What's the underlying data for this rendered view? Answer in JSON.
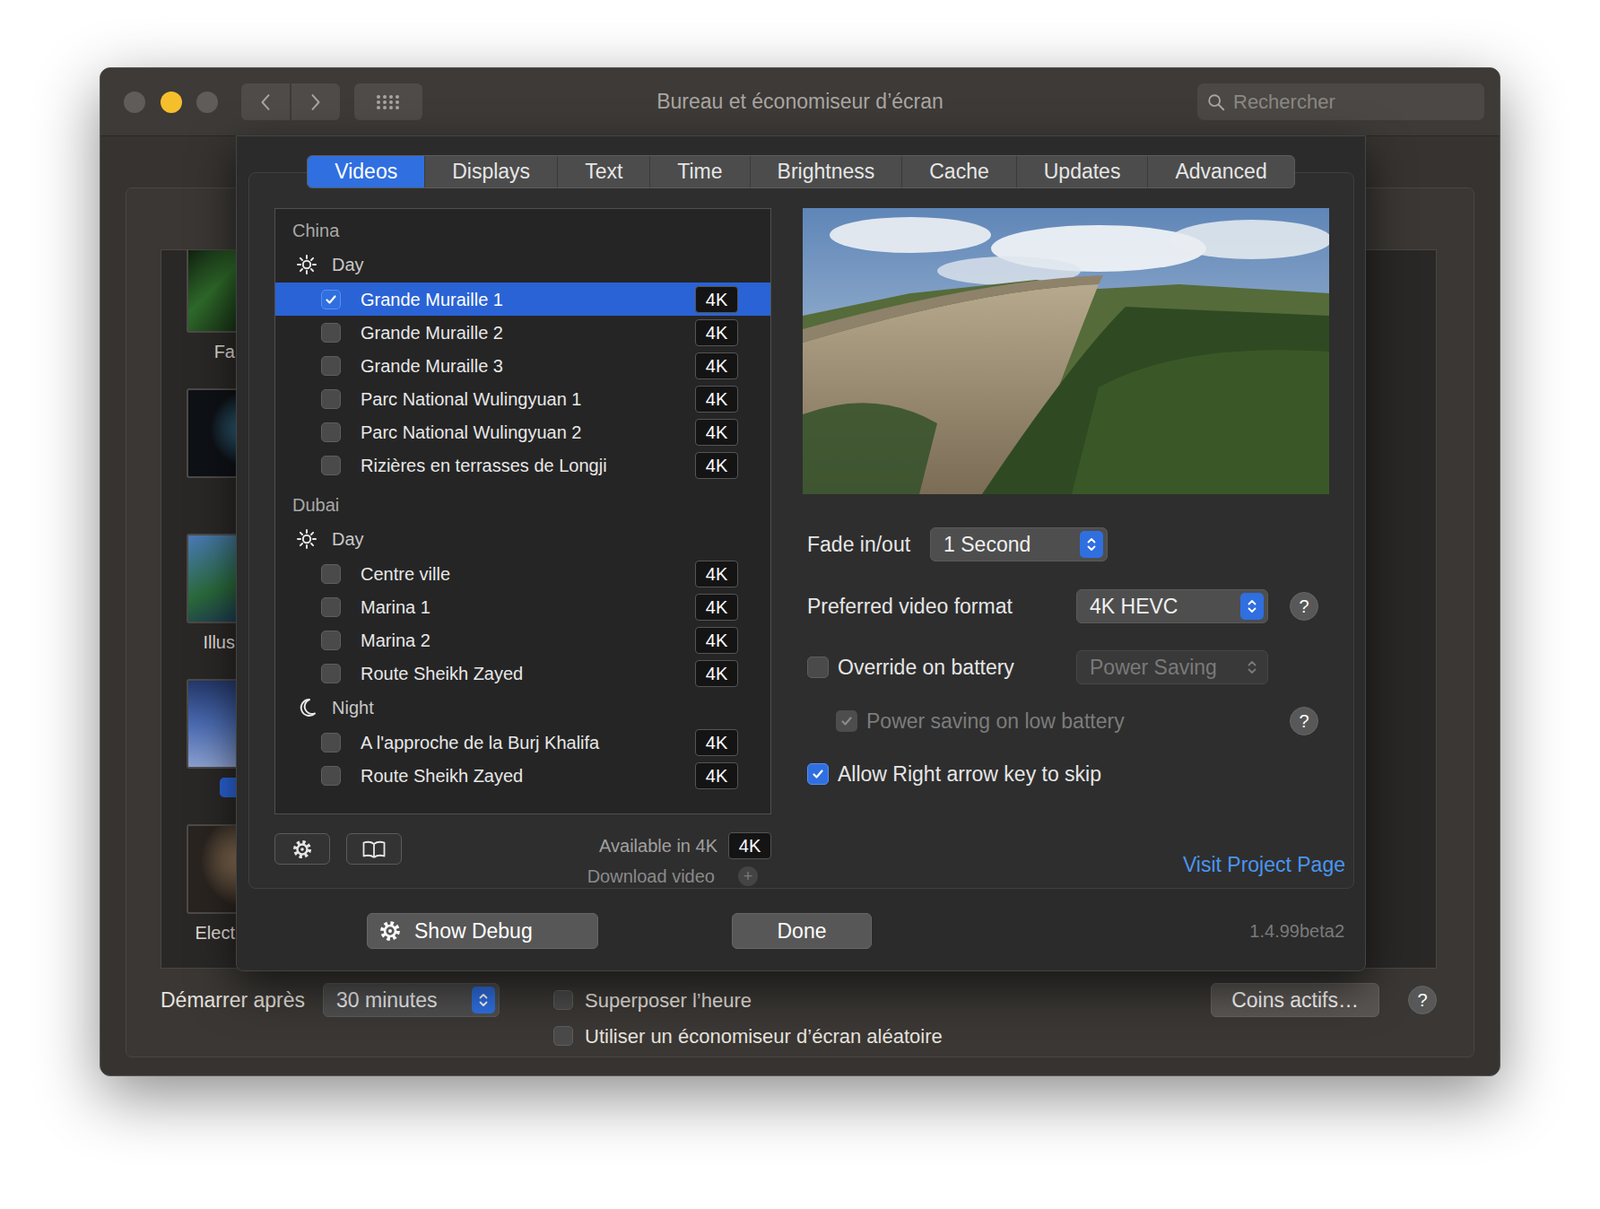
{
  "window": {
    "title": "Bureau et économiseur d’écran",
    "search": {
      "placeholder": "Rechercher"
    }
  },
  "screensavers": [
    {
      "label": "Fa",
      "selected": false
    },
    {
      "selected": false
    },
    {
      "label": "Illus",
      "selected": false
    },
    {
      "selected": true
    },
    {
      "label": "Elect",
      "selected": false
    }
  ],
  "sheet": {
    "tabs": [
      {
        "label": "Videos",
        "selected": true
      },
      {
        "label": "Displays",
        "selected": false
      },
      {
        "label": "Text",
        "selected": false
      },
      {
        "label": "Time",
        "selected": false
      },
      {
        "label": "Brightness",
        "selected": false
      },
      {
        "label": "Cache",
        "selected": false
      },
      {
        "label": "Updates",
        "selected": false
      },
      {
        "label": "Advanced",
        "selected": false
      }
    ],
    "video_list": {
      "groups": [
        {
          "name": "China",
          "sections": [
            {
              "label": "Day",
              "kind": "day",
              "items": [
                {
                  "title": "Grande Muraille 1",
                  "badge": "4K",
                  "checked": true,
                  "selected": true
                },
                {
                  "title": "Grande Muraille 2",
                  "badge": "4K",
                  "checked": false,
                  "selected": false
                },
                {
                  "title": "Grande Muraille 3",
                  "badge": "4K",
                  "checked": false,
                  "selected": false
                },
                {
                  "title": "Parc National Wulingyuan 1",
                  "badge": "4K",
                  "checked": false,
                  "selected": false
                },
                {
                  "title": "Parc National Wulingyuan 2",
                  "badge": "4K",
                  "checked": false,
                  "selected": false
                },
                {
                  "title": "Rizières en terrasses de Longji",
                  "badge": "4K",
                  "checked": false,
                  "selected": false
                }
              ]
            }
          ]
        },
        {
          "name": "Dubai",
          "sections": [
            {
              "label": "Day",
              "kind": "day",
              "items": [
                {
                  "title": "Centre ville",
                  "badge": "4K",
                  "checked": false,
                  "selected": false
                },
                {
                  "title": "Marina 1",
                  "badge": "4K",
                  "checked": false,
                  "selected": false
                },
                {
                  "title": "Marina 2",
                  "badge": "4K",
                  "checked": false,
                  "selected": false
                },
                {
                  "title": "Route Sheikh Zayed",
                  "badge": "4K",
                  "checked": false,
                  "selected": false
                }
              ]
            },
            {
              "label": "Night",
              "kind": "night",
              "items": [
                {
                  "title": "A l'approche de la Burj Khalifa",
                  "badge": "4K",
                  "checked": false,
                  "selected": false
                },
                {
                  "title": "Route Sheikh Zayed",
                  "badge": "4K",
                  "checked": false,
                  "selected": false
                }
              ]
            }
          ]
        }
      ]
    },
    "list_footer": {
      "available": {
        "label": "Available in 4K",
        "badge": "4K"
      },
      "download": {
        "label": "Download video",
        "icon": "+",
        "disabled": true
      }
    },
    "settings": [
      {
        "kind": "popup",
        "label": "Fade in/out",
        "value": "1 Second"
      },
      {
        "kind": "popup",
        "label": "Preferred video format",
        "value": "4K HEVC",
        "help": "?"
      },
      {
        "kind": "checkbox-popup",
        "label": "Override on battery",
        "checked": false,
        "value": "Power Saving",
        "popup_disabled": true
      },
      {
        "kind": "sub-checkbox",
        "label": "Power saving on low battery",
        "checked": true,
        "disabled": true,
        "help": "?"
      },
      {
        "kind": "checkbox",
        "label": "Allow Right arrow key to skip",
        "checked": true,
        "disabled": false
      }
    ],
    "link": "Visit Project Page",
    "buttons": [
      {
        "label": "Show Debug"
      },
      {
        "label": "Done"
      }
    ],
    "version": "1.4.99beta2"
  },
  "footer": {
    "start_after": {
      "label": "Démarrer après",
      "value": "30 minutes"
    },
    "checkboxes": [
      {
        "label": "Superposer l’heure",
        "checked": false
      },
      {
        "label": "Utiliser un économiseur d’écran aléatoire",
        "checked": false
      }
    ],
    "hot_corners": "Coins actifs…",
    "help": "?"
  }
}
